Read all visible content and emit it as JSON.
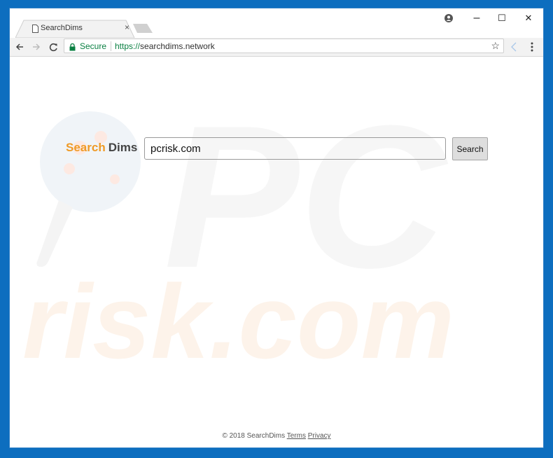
{
  "browser": {
    "tab_title": "SearchDims",
    "tab_close": "×",
    "address": {
      "secure_label": "Secure",
      "url_scheme": "https://",
      "url_host": "searchdims.network"
    },
    "window_controls": {
      "minimize": "–",
      "maximize": "☐",
      "close": "✕"
    },
    "bookmark_glyph": "☆"
  },
  "page": {
    "brand": {
      "part1": "Search",
      "part2": "Dims"
    },
    "search": {
      "value": "pcrisk.com",
      "button_label": "Search"
    },
    "footer": {
      "copyright": "© 2018 SearchDims",
      "terms": "Terms",
      "privacy": "Privacy"
    },
    "watermark": {
      "text1": "PC",
      "text2": "risk.com"
    }
  },
  "colors": {
    "brand_orange": "#ef9a26",
    "secure_green": "#0b8043",
    "desktop_blue": "#0d6ebf"
  }
}
